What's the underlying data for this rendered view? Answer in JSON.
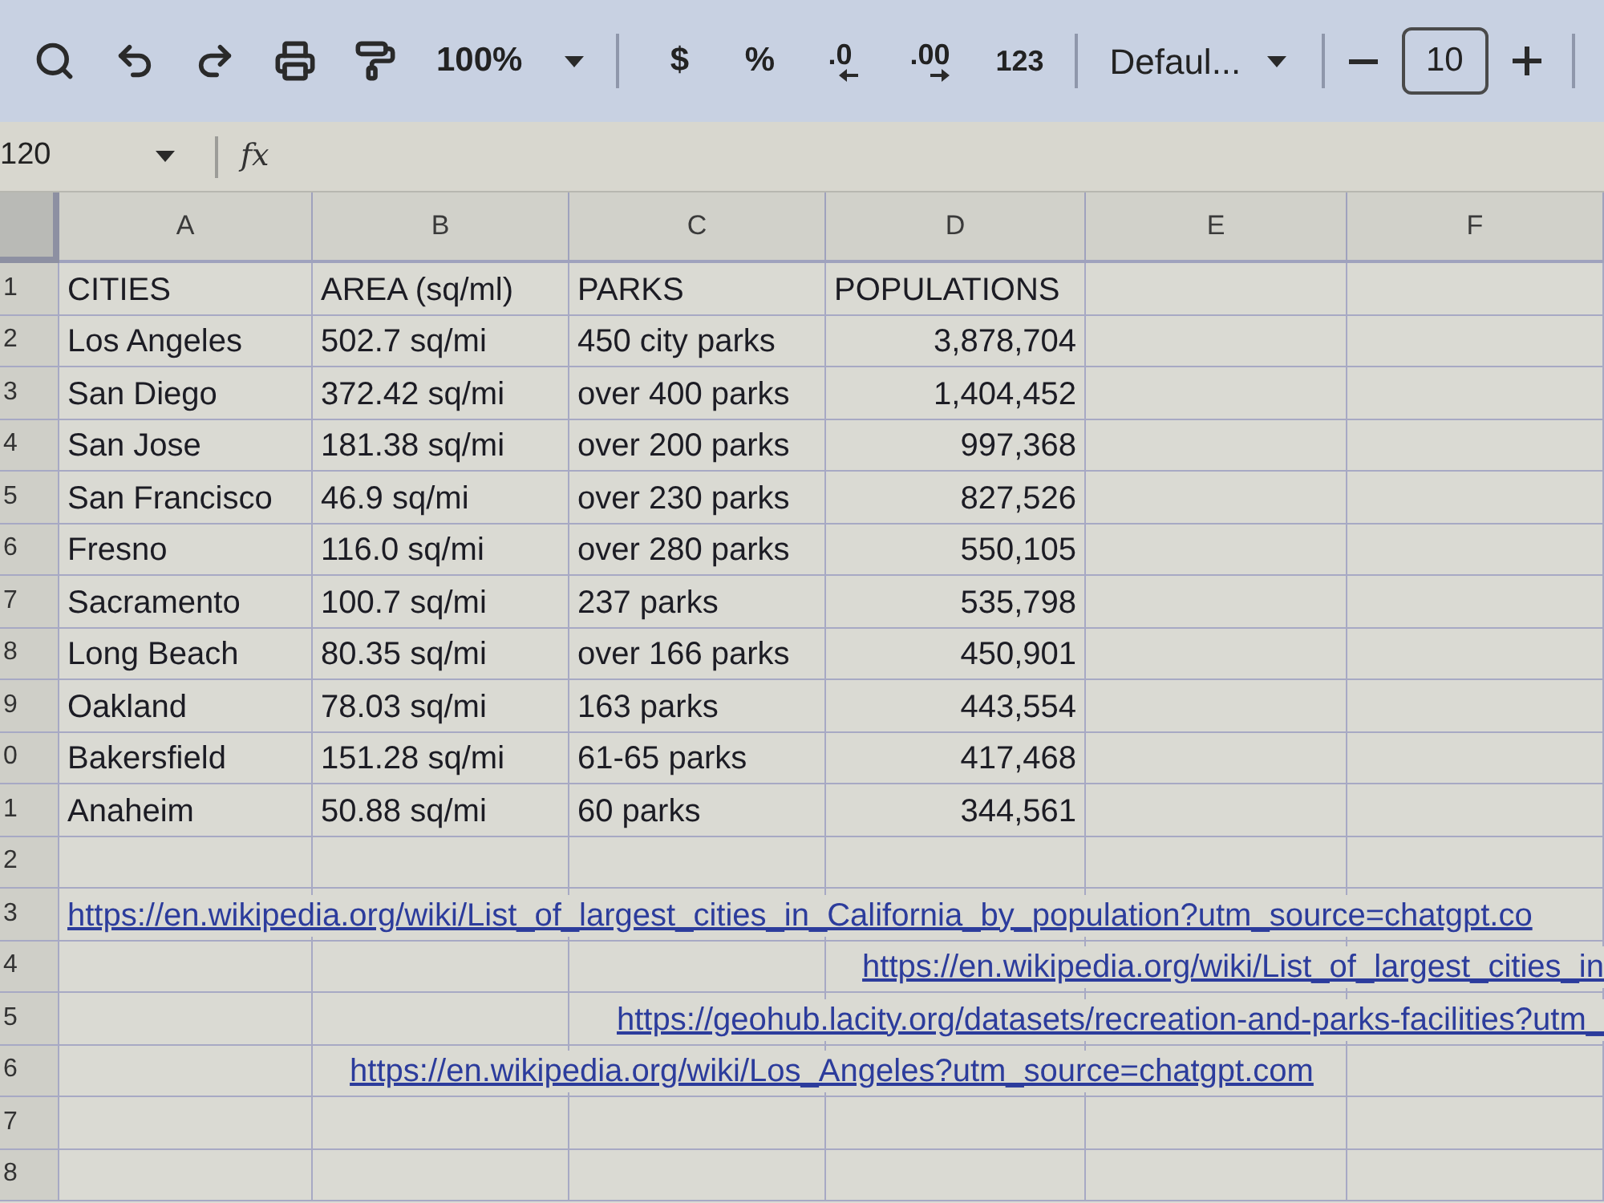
{
  "toolbar": {
    "zoom": "100%",
    "currency": "$",
    "percent": "%",
    "decrease_decimals": ".0",
    "increase_decimals": ".00",
    "number_format": "123",
    "font": "Defaul...",
    "font_size": "10"
  },
  "formula_bar": {
    "cell_reference": "120",
    "function_label": "fx"
  },
  "sheet": {
    "columns": [
      {
        "letter": "A",
        "right_aligned": false
      },
      {
        "letter": "B",
        "right_aligned": false
      },
      {
        "letter": "C",
        "right_aligned": false
      },
      {
        "letter": "D",
        "right_aligned": true
      },
      {
        "letter": "E"
      },
      {
        "letter": "F"
      }
    ],
    "rows": [
      {
        "number": "1",
        "kind": "header",
        "cells": [
          "CITIES",
          "AREA (sq/ml)",
          "PARKS",
          "POPULATIONS"
        ]
      },
      {
        "number": "2",
        "kind": "data",
        "cells": [
          "Los Angeles",
          "502.7 sq/mi",
          "450 city parks",
          "3,878,704"
        ]
      },
      {
        "number": "3",
        "kind": "data",
        "cells": [
          "San Diego",
          "372.42 sq/mi",
          "over 400 parks",
          "1,404,452"
        ]
      },
      {
        "number": "4",
        "kind": "data",
        "cells": [
          "San Jose",
          "181.38 sq/mi",
          "over 200 parks",
          "997,368"
        ]
      },
      {
        "number": "5",
        "kind": "data",
        "cells": [
          "San Francisco",
          "46.9 sq/mi",
          "over 230 parks",
          "827,526"
        ]
      },
      {
        "number": "6",
        "kind": "data",
        "cells": [
          "Fresno",
          "116.0 sq/mi",
          "over 280 parks",
          "550,105"
        ]
      },
      {
        "number": "7",
        "kind": "data",
        "cells": [
          "Sacramento",
          "100.7 sq/mi",
          "237 parks",
          "535,798"
        ]
      },
      {
        "number": "8",
        "kind": "data",
        "cells": [
          "Long Beach",
          "80.35 sq/mi",
          "over 166 parks",
          "450,901"
        ]
      },
      {
        "number": "9",
        "kind": "data",
        "cells": [
          "Oakland",
          "78.03 sq/mi",
          "163 parks",
          "443,554"
        ]
      },
      {
        "number": "0",
        "kind": "data",
        "cells": [
          "Bakersfield",
          "151.28 sq/mi",
          "61-65 parks",
          "417,468"
        ]
      },
      {
        "number": "1",
        "kind": "data",
        "cells": [
          "Anaheim",
          "50.88 sq/mi",
          "60 parks",
          "344,561"
        ]
      },
      {
        "number": "2",
        "kind": "empty"
      },
      {
        "number": "3",
        "kind": "link",
        "right_aligned": false,
        "centered": false,
        "text": "https://en.wikipedia.org/wiki/List_of_largest_cities_in_California_by_population?utm_source=chatgpt.co"
      },
      {
        "number": "4",
        "kind": "link",
        "right_aligned": true,
        "centered": false,
        "text": "https://en.wikipedia.org/wiki/List_of_largest_cities_in"
      },
      {
        "number": "5",
        "kind": "link",
        "right_aligned": true,
        "centered": false,
        "text": "https://geohub.lacity.org/datasets/recreation-and-parks-facilities?utm_"
      },
      {
        "number": "6",
        "kind": "link",
        "right_aligned": false,
        "centered": true,
        "text": "https://en.wikipedia.org/wiki/Los_Angeles?utm_source=chatgpt.com"
      },
      {
        "number": "7",
        "kind": "empty"
      },
      {
        "number": "8",
        "kind": "empty"
      }
    ]
  }
}
